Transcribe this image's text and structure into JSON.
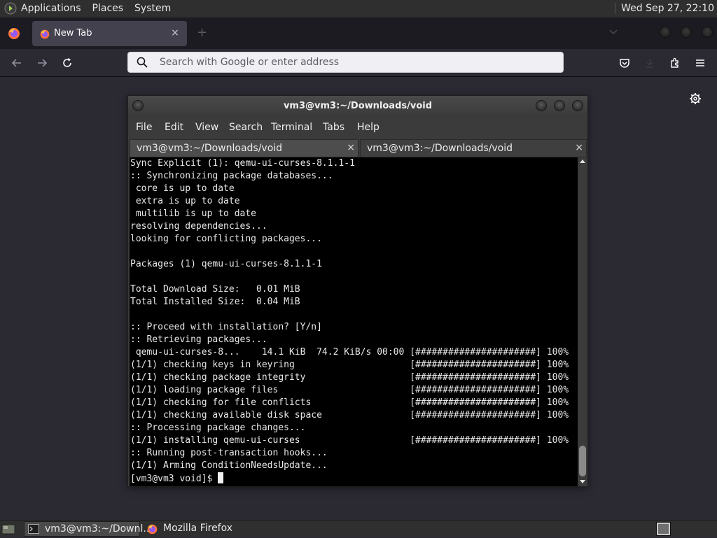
{
  "top_panel": {
    "menus": [
      "Applications",
      "Places",
      "System"
    ],
    "clock": "Wed Sep 27, 22:10"
  },
  "firefox": {
    "tab_label": "New Tab",
    "tab_close": "×",
    "new_tab": "+",
    "url_placeholder": "Search with Google or enter address"
  },
  "terminal": {
    "title": "vm3@vm3:~/Downloads/void",
    "menus": [
      "File",
      "Edit",
      "View",
      "Search",
      "Terminal",
      "Tabs",
      "Help"
    ],
    "tabs": [
      {
        "label": "vm3@vm3:~/Downloads/void",
        "close": "×"
      },
      {
        "label": "vm3@vm3:~/Downloads/void",
        "close": "×"
      }
    ],
    "lines": [
      "Sync Explicit (1): qemu-ui-curses-8.1.1-1",
      ":: Synchronizing package databases...",
      " core is up to date",
      " extra is up to date",
      " multilib is up to date",
      "resolving dependencies...",
      "looking for conflicting packages...",
      "",
      "Packages (1) qemu-ui-curses-8.1.1-1",
      "",
      "Total Download Size:   0.01 MiB",
      "Total Installed Size:  0.04 MiB",
      "",
      ":: Proceed with installation? [Y/n]",
      ":: Retrieving packages...",
      " qemu-ui-curses-8...    14.1 KiB  74.2 KiB/s 00:00 [######################] 100%",
      "(1/1) checking keys in keyring                     [######################] 100%",
      "(1/1) checking package integrity                   [######################] 100%",
      "(1/1) loading package files                        [######################] 100%",
      "(1/1) checking for file conflicts                  [######################] 100%",
      "(1/1) checking available disk space                [######################] 100%",
      ":: Processing package changes...",
      "(1/1) installing qemu-ui-curses                    [######################] 100%",
      ":: Running post-transaction hooks...",
      "(1/1) Arming ConditionNeedsUpdate..."
    ],
    "prompt": "[vm3@vm3 void]$ "
  },
  "taskbar": {
    "tasks": [
      "vm3@vm3:~/Downl...",
      "Mozilla Firefox"
    ]
  },
  "icons": {
    "panel_logo": "gnome-foot-icon",
    "firefox": "firefox-icon",
    "terminal": "terminal-icon",
    "settings": "gear-icon"
  }
}
